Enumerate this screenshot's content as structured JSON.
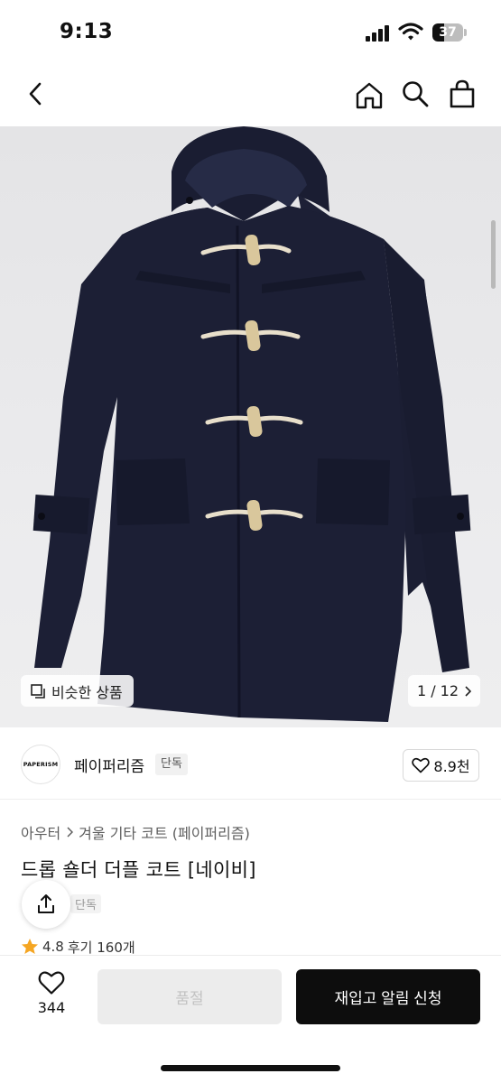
{
  "status_bar": {
    "time": "9:13",
    "battery_level": "37",
    "icons": [
      "signal-icon",
      "wifi-icon",
      "battery-icon"
    ]
  },
  "nav": {
    "icons": [
      "back-icon",
      "home-icon",
      "search-icon",
      "shopping-bag-icon"
    ]
  },
  "gallery": {
    "similar_label": "비슷한 상품",
    "page_counter": "1 / 12",
    "image_alt": "navy duffle coat"
  },
  "brand": {
    "logo_text": "PAPERISM",
    "name": "페이퍼리즘",
    "badge": "단독",
    "likes": "8.9천"
  },
  "product": {
    "breadcrumb": [
      "아우터",
      "겨울 기타 코트 (페이퍼리즘)"
    ],
    "title": "드롭 숄더 더플 코트 [네이비]",
    "tag": "단독",
    "rating": "4.8",
    "reviews": "후기 160개"
  },
  "bottom_bar": {
    "wish_count": "344",
    "soldout_label": "품절",
    "restock_label": "재입고 알림 신청"
  },
  "colors": {
    "primary_button": "#0d0d0d",
    "disabled_button": "#ececec",
    "star": "#f5a623",
    "coat_navy": "#1b1e33"
  }
}
